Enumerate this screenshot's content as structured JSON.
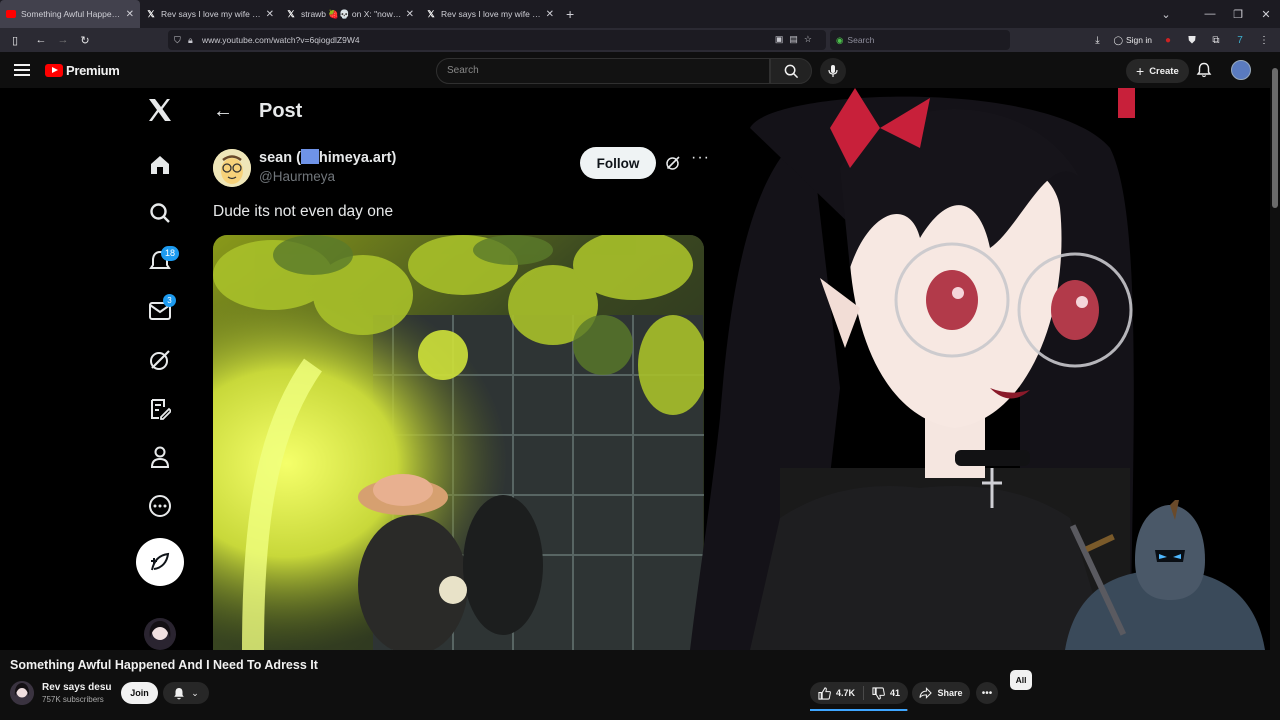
{
  "browser": {
    "tabs": [
      {
        "title": "Something Awful Happened An",
        "favicon": "youtube-icon",
        "active": true
      },
      {
        "title": "Rev says I love my wife (@Rev_s",
        "favicon": "x-icon",
        "active": false
      },
      {
        "title": "strawb 🍓💀 on X: \"now THIS",
        "favicon": "x-icon",
        "active": false
      },
      {
        "title": "Rev says I love my wife on X: \"-",
        "favicon": "x-icon",
        "active": false
      }
    ],
    "url": "www.youtube.com/watch?v=6qiogdlZ9W4",
    "search_placeholder": "Search",
    "sign_in_label": "Sign in"
  },
  "youtube": {
    "logo_text": "Premium",
    "search_placeholder": "Search",
    "create_label": "Create",
    "video_title": "Something Awful Happened And I Need To Adress It",
    "channel_name": "Rev says desu",
    "subscribers": "757K subscribers",
    "join_label": "Join",
    "likes": "4.7K",
    "dislikes": "41",
    "share_label": "Share",
    "chip_all": "All",
    "like_ratio": 0.99
  },
  "x_post": {
    "header_title": "Post",
    "author_name_prefix": "sean (",
    "author_name_suffix": "himeya.art)",
    "author_handle": "@Haurmeya",
    "follow_label": "Follow",
    "text": "Dude its not even day one",
    "badges": {
      "notifications": "18",
      "messages": "3"
    }
  },
  "colors": {
    "x_blue": "#1d9bf0",
    "youtube_red": "#ff0000",
    "like_bar": "#3ea6ff"
  }
}
